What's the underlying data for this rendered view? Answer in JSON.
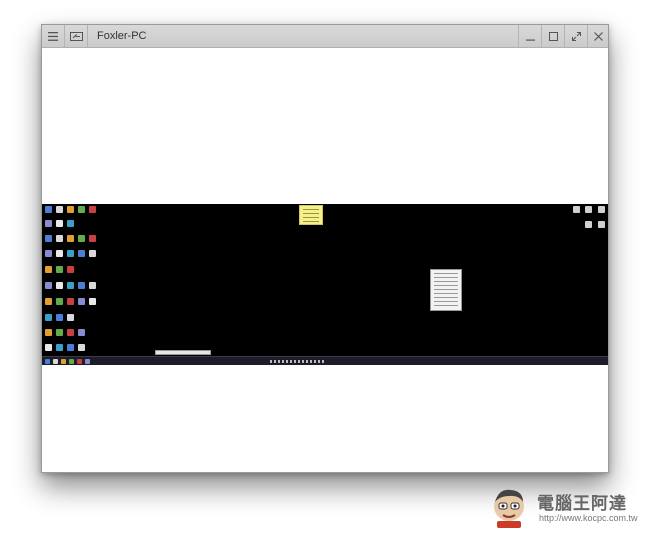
{
  "window": {
    "title": "Foxler-PC",
    "menu_icon": "hamburger-icon",
    "screen_icon": "screen-share-icon",
    "controls": [
      "minimize-icon",
      "maximize-icon",
      "fullscreen-icon",
      "close-icon"
    ]
  },
  "watermark": {
    "title": "電腦王阿達",
    "url": "http://www.kocpc.com.tw"
  },
  "colors": {
    "titlebar": "#cfcfcf",
    "desktop": "#000000",
    "sticky_note": "#f6ef8a"
  }
}
